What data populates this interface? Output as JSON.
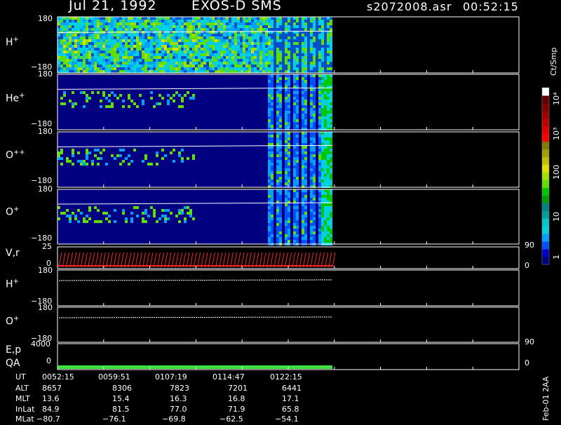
{
  "header": {
    "date": "Jul 21, 1992",
    "instrument": "EXOS-D SMS",
    "filename": "s2072008.asr",
    "time": "00:52:15"
  },
  "panels": [
    {
      "label": "H",
      "sup": "+",
      "ymax": "180",
      "ymin": "−180"
    },
    {
      "label": "He",
      "sup": "+",
      "ymax": "180",
      "ymin": "−180"
    },
    {
      "label": "O",
      "sup": "++",
      "ymax": "180",
      "ymin": "−180"
    },
    {
      "label": "O",
      "sup": "+",
      "ymax": "180",
      "ymin": "−180"
    }
  ],
  "vr_panel": {
    "label": "V,r",
    "left_top": "25",
    "left_bottom": "0",
    "right_top": "90",
    "right_bottom": "0"
  },
  "lower_panels": [
    {
      "label": "H",
      "sup": "+",
      "ymax": "180",
      "ymin": "−180"
    },
    {
      "label": "O",
      "sup": "+",
      "ymax": "180",
      "ymin": "−180"
    }
  ],
  "ep_panel": {
    "label_top": "E,p",
    "label_bottom": "QA",
    "left_top": "4000",
    "left_bottom": "0",
    "right_top": "90",
    "right_bottom": "0"
  },
  "colorbar": {
    "unit": "Ct/Smp",
    "ticks": [
      "1",
      "10",
      "100",
      "10³",
      "10⁴"
    ],
    "colors": [
      "#000080",
      "#0000c8",
      "#0050ff",
      "#00a0ff",
      "#00d0e0",
      "#00c8c8",
      "#00a0a0",
      "#008080",
      "#00a000",
      "#00c800",
      "#60e000",
      "#a0e000",
      "#e0e000",
      "#c0c000",
      "#a0a000",
      "#808000",
      "#ff0000",
      "#e00000",
      "#c00000",
      "#a00000",
      "#800000",
      "#600000",
      "#ffffff"
    ]
  },
  "footer": {
    "rows": [
      {
        "name": "UT",
        "values": [
          "0052:15",
          "0059:51",
          "0107:19",
          "0114:47",
          "0122:15"
        ]
      },
      {
        "name": "ALT",
        "values": [
          "8657",
          "8306",
          "7823",
          "7201",
          "6441"
        ]
      },
      {
        "name": "MLT",
        "values": [
          "13.6",
          "15.4",
          "16.3",
          "16.8",
          "17.1"
        ]
      },
      {
        "name": "InLat",
        "values": [
          "84.9",
          "81.5",
          "77.0",
          "71.9",
          "65.8"
        ]
      },
      {
        "name": "MLat",
        "values": [
          "−80.7",
          "−76.1",
          "−69.8",
          "−62.5",
          "−54.1"
        ]
      }
    ],
    "stamp": "Feb-01 2AA"
  },
  "chart_data": {
    "type": "heatmap",
    "title": "Jul 21, 1992   EXOS-D SMS",
    "x": [
      "0052:15",
      "0059:51",
      "0107:19",
      "0114:47",
      "0122:15"
    ],
    "ylim": [
      -180,
      180
    ],
    "series": [
      {
        "name": "H+"
      },
      {
        "name": "He+"
      },
      {
        "name": "O++"
      },
      {
        "name": "O+"
      }
    ],
    "colorbar_range": [
      1,
      10000
    ],
    "colorbar_scale": "log"
  }
}
